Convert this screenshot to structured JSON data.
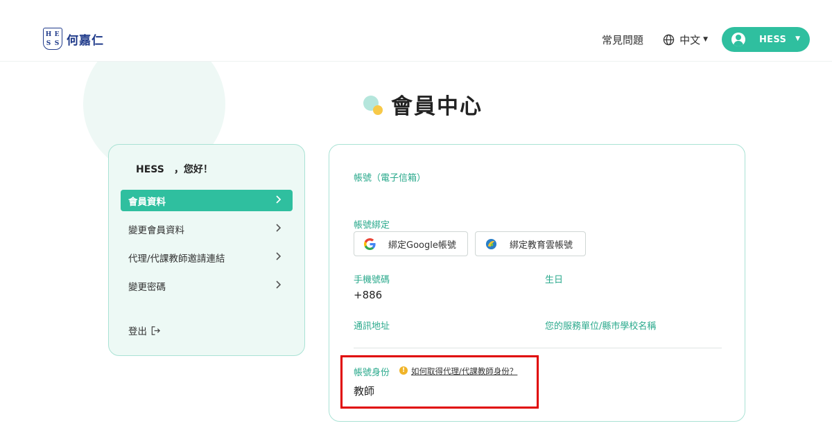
{
  "header": {
    "logo_text": "何嘉仁",
    "logo_mark_letters": [
      "H",
      "E",
      "S",
      "S"
    ],
    "nav_faq": "常見問題",
    "nav_lang": "中文",
    "user_name": "HESS",
    "accent_color": "#2fbf9f"
  },
  "title": "會員中心",
  "sidebar": {
    "greeting": "HESS　，您好！",
    "items": [
      {
        "label": "會員資料",
        "active": true
      },
      {
        "label": "變更會員資料",
        "active": false
      },
      {
        "label": "代理/代課教師邀請連結",
        "active": false
      },
      {
        "label": "變更密碼",
        "active": false
      }
    ],
    "logout_label": "登出"
  },
  "main": {
    "account_email_label": "帳號（電子信箱）",
    "account_email_value": "",
    "binding_label": "帳號綁定",
    "bind_google_label": "綁定Google帳號",
    "bind_edu_label": "綁定教育雲帳號",
    "phone_label": "手機號碼",
    "phone_value": "+886",
    "birthday_label": "生日",
    "birthday_value": "",
    "address_label": "通訊地址",
    "address_value": "",
    "school_label": "您的服務單位/縣市學校名稱",
    "school_value": "",
    "identity_label": "帳號身份",
    "identity_help_link": "如何取得代理/代課教師身份？",
    "identity_value": "教師"
  }
}
